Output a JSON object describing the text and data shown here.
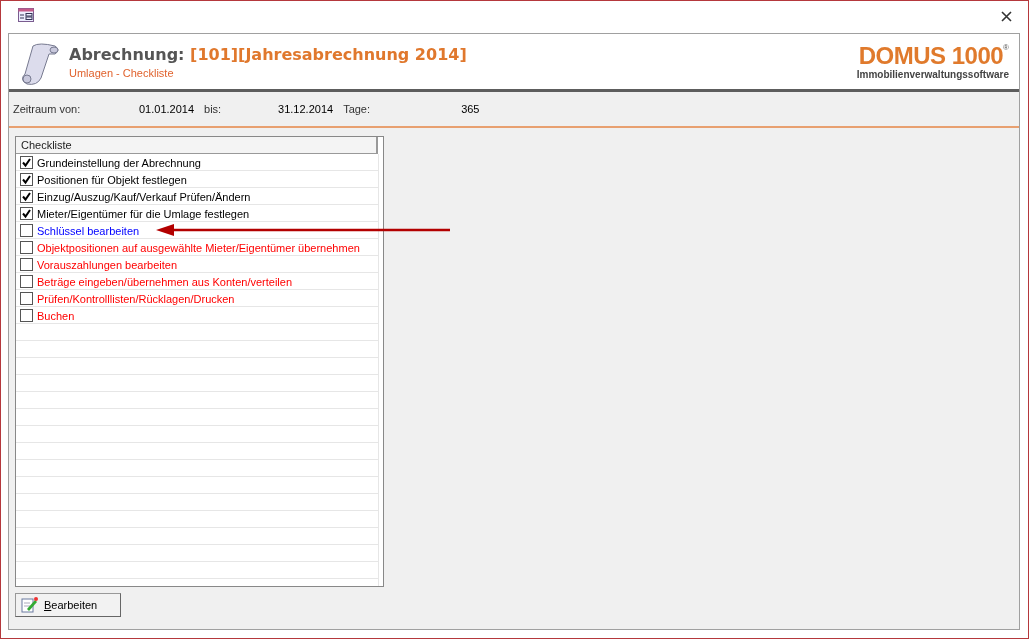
{
  "header": {
    "title": "Abrechnung:",
    "record": "[101][Jahresabrechnung 2014]",
    "subtitle": "Umlagen - Checkliste",
    "logo_name": "DOMUS 1000",
    "logo_mark": "®",
    "logo_tagline": "Immobilienverwaltungssoftware"
  },
  "period": {
    "from_label": "Zeitraum von:",
    "from": "01.01.2014",
    "to_label": "bis:",
    "to": "31.12.2014",
    "days_label": "Tage:",
    "days": "365"
  },
  "checklist": {
    "column": "Checkliste",
    "items": [
      {
        "label": "Grundeinstellung der Abrechnung",
        "checked": true,
        "color": "#000000"
      },
      {
        "label": "Positionen für Objekt festlegen",
        "checked": true,
        "color": "#000000"
      },
      {
        "label": "Einzug/Auszug/Kauf/Verkauf Prüfen/Ändern",
        "checked": true,
        "color": "#000000"
      },
      {
        "label": "Mieter/Eigentümer für die Umlage festlegen",
        "checked": true,
        "color": "#000000"
      },
      {
        "label": "Schlüssel bearbeiten",
        "checked": false,
        "color": "#0000ff"
      },
      {
        "label": "Objektpositionen auf ausgewählte Mieter/Eigentümer übernehmen",
        "checked": false,
        "color": "#ff0000"
      },
      {
        "label": "Vorauszahlungen bearbeiten",
        "checked": false,
        "color": "#ff0000"
      },
      {
        "label": "Beträge eingeben/übernehmen aus Konten/verteilen",
        "checked": false,
        "color": "#ff0000"
      },
      {
        "label": "Prüfen/Kontrolllisten/Rücklagen/Drucken",
        "checked": false,
        "color": "#ff0000"
      },
      {
        "label": "Buchen",
        "checked": false,
        "color": "#ff0000"
      }
    ]
  },
  "buttons": [
    "Bearbeiten"
  ]
}
